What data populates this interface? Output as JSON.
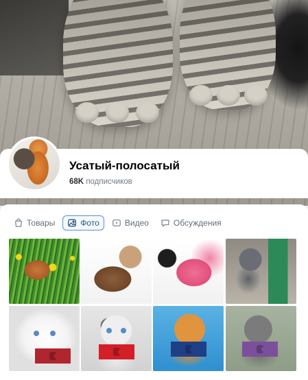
{
  "group": {
    "name": "Усатый-полосатый",
    "subscribers_count": "68K",
    "subscribers_label": "подписчиков"
  },
  "tabs": [
    {
      "label": "Товары",
      "icon": "shopping-bag-icon",
      "active": false
    },
    {
      "label": "Фото",
      "icon": "photo-icon",
      "active": true
    },
    {
      "label": "Видео",
      "icon": "video-play-icon",
      "active": false
    },
    {
      "label": "Обсуждения",
      "icon": "chat-bubble-icon",
      "active": false
    }
  ],
  "photos": [
    {
      "subject": "orange kitten in grass with dandelions"
    },
    {
      "subject": "cat in brown coat"
    },
    {
      "subject": "black cat in pink dress"
    },
    {
      "subject": "grey kitten"
    },
    {
      "subject": "white cat with red plaid bow tie"
    },
    {
      "subject": "white cat with red bow tie"
    },
    {
      "subject": "ginger cat with blue bow tie"
    },
    {
      "subject": "grey cat with purple bow tie"
    }
  ],
  "colors": {
    "accent": "#2a5885",
    "active_tab_border": "#5a8ed6",
    "secondary_text": "#6d7885",
    "page_background": "#edeef0"
  }
}
